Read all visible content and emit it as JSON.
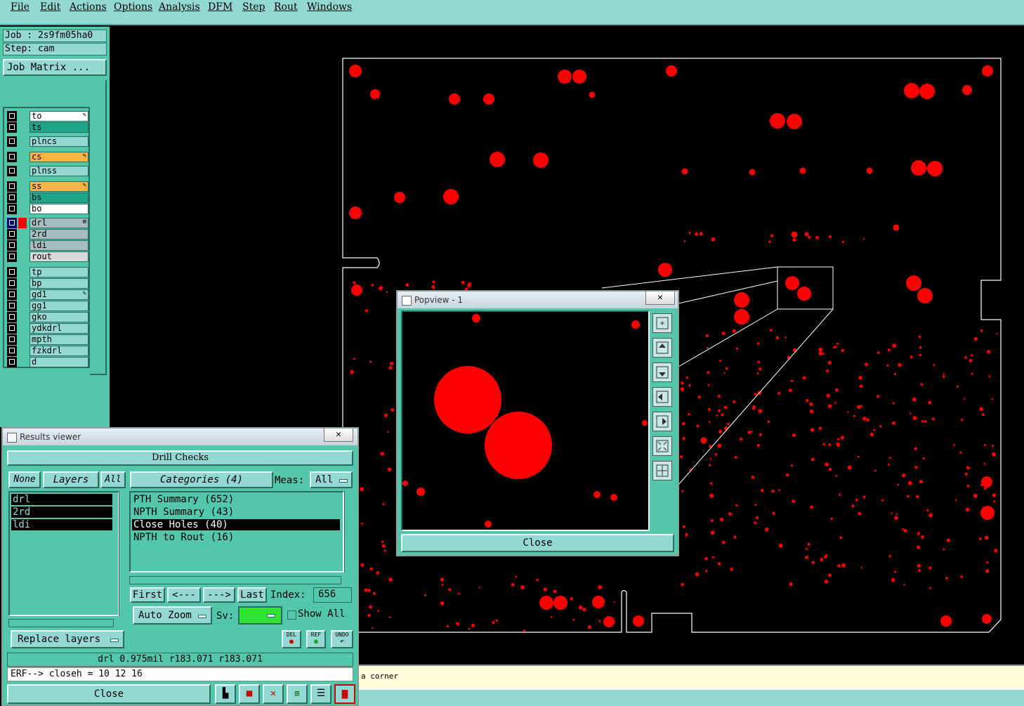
{
  "menubar": {
    "items": [
      "File",
      "Edit",
      "Actions",
      "Options",
      "Analysis",
      "DFM",
      "Step",
      "Rout",
      "Windows"
    ]
  },
  "leftpanel": {
    "job": "Job : 2s9fm05ha0",
    "step": "Step: cam",
    "job_matrix": "Job Matrix ..."
  },
  "layers": [
    {
      "name": "to",
      "color": "#ffffff",
      "mark": "✎"
    },
    {
      "name": "ts",
      "color": "#1fa58a",
      "mark": ""
    },
    {
      "name": "plncs",
      "color": "#94d8d4",
      "mark": ""
    },
    {
      "name": "cs",
      "color": "#ffb443",
      "mark": "✎"
    },
    {
      "name": "plnss",
      "color": "#94d8d4",
      "mark": ""
    },
    {
      "name": "ss",
      "color": "#ffb443",
      "mark": "✎"
    },
    {
      "name": "bs",
      "color": "#1fa58a",
      "mark": ""
    },
    {
      "name": "bo",
      "color": "#ffffff",
      "mark": ""
    },
    {
      "name": "drl",
      "color": "#a9bcc0",
      "mark": "⊞"
    },
    {
      "name": "2rd",
      "color": "#a9bcc0",
      "mark": ""
    },
    {
      "name": "ldi",
      "color": "#a9bcc0",
      "mark": ""
    },
    {
      "name": "rout",
      "color": "#d8d8d8",
      "mark": ""
    },
    {
      "name": "tp",
      "color": "#94d8d4",
      "mark": ""
    },
    {
      "name": "bp",
      "color": "#94d8d4",
      "mark": ""
    },
    {
      "name": "gd1",
      "color": "#94d8d4",
      "mark": "✎"
    },
    {
      "name": "gg1",
      "color": "#94d8d4",
      "mark": ""
    },
    {
      "name": "gko",
      "color": "#94d8d4",
      "mark": ""
    },
    {
      "name": "ydkdrl",
      "color": "#94d8d4",
      "mark": ""
    },
    {
      "name": "mpth",
      "color": "#94d8d4",
      "mark": ""
    },
    {
      "name": "fzkdrl",
      "color": "#94d8d4",
      "mark": ""
    },
    {
      "name": "d",
      "color": "#94d8d4",
      "mark": ""
    }
  ],
  "results": {
    "title": "Results viewer",
    "close_x": "✕",
    "header": "Drill Checks",
    "none_btn": "None",
    "layers_btn": "Layers",
    "all_btn": "All",
    "categories_btn": "Categories (4)",
    "meas_label": "Meas:",
    "meas_value": "All",
    "layer_list": [
      "drl",
      "2rd",
      "ldi"
    ],
    "categories": [
      "PTH Summary (652)",
      "NPTH Summary (43)",
      "Close Holes (40)",
      "NPTH to Rout (16)"
    ],
    "selected_category": 2,
    "first": "First",
    "prev": "<---",
    "next": "--->",
    "last": "Last",
    "index_label": "Index:",
    "index_value": "656",
    "autozoom": "Auto Zoom",
    "sv_label": "Sv:",
    "show_all": "Show All",
    "replace_layers": "Replace layers",
    "del": "DEL",
    "ref": "REF",
    "undo": "UNDO",
    "measure": "drl 0.975mil   r183.071  r183.071",
    "erf": "ERF--> closeh = 10 12 16",
    "close": "Close"
  },
  "popview": {
    "title": "Popview - 1",
    "close_x": "✕",
    "close": "Close"
  },
  "status": {
    "text": "a corner"
  },
  "colors": {
    "pad": "#ff0000",
    "panel": "#52c7a9",
    "light": "#94d8d4"
  }
}
